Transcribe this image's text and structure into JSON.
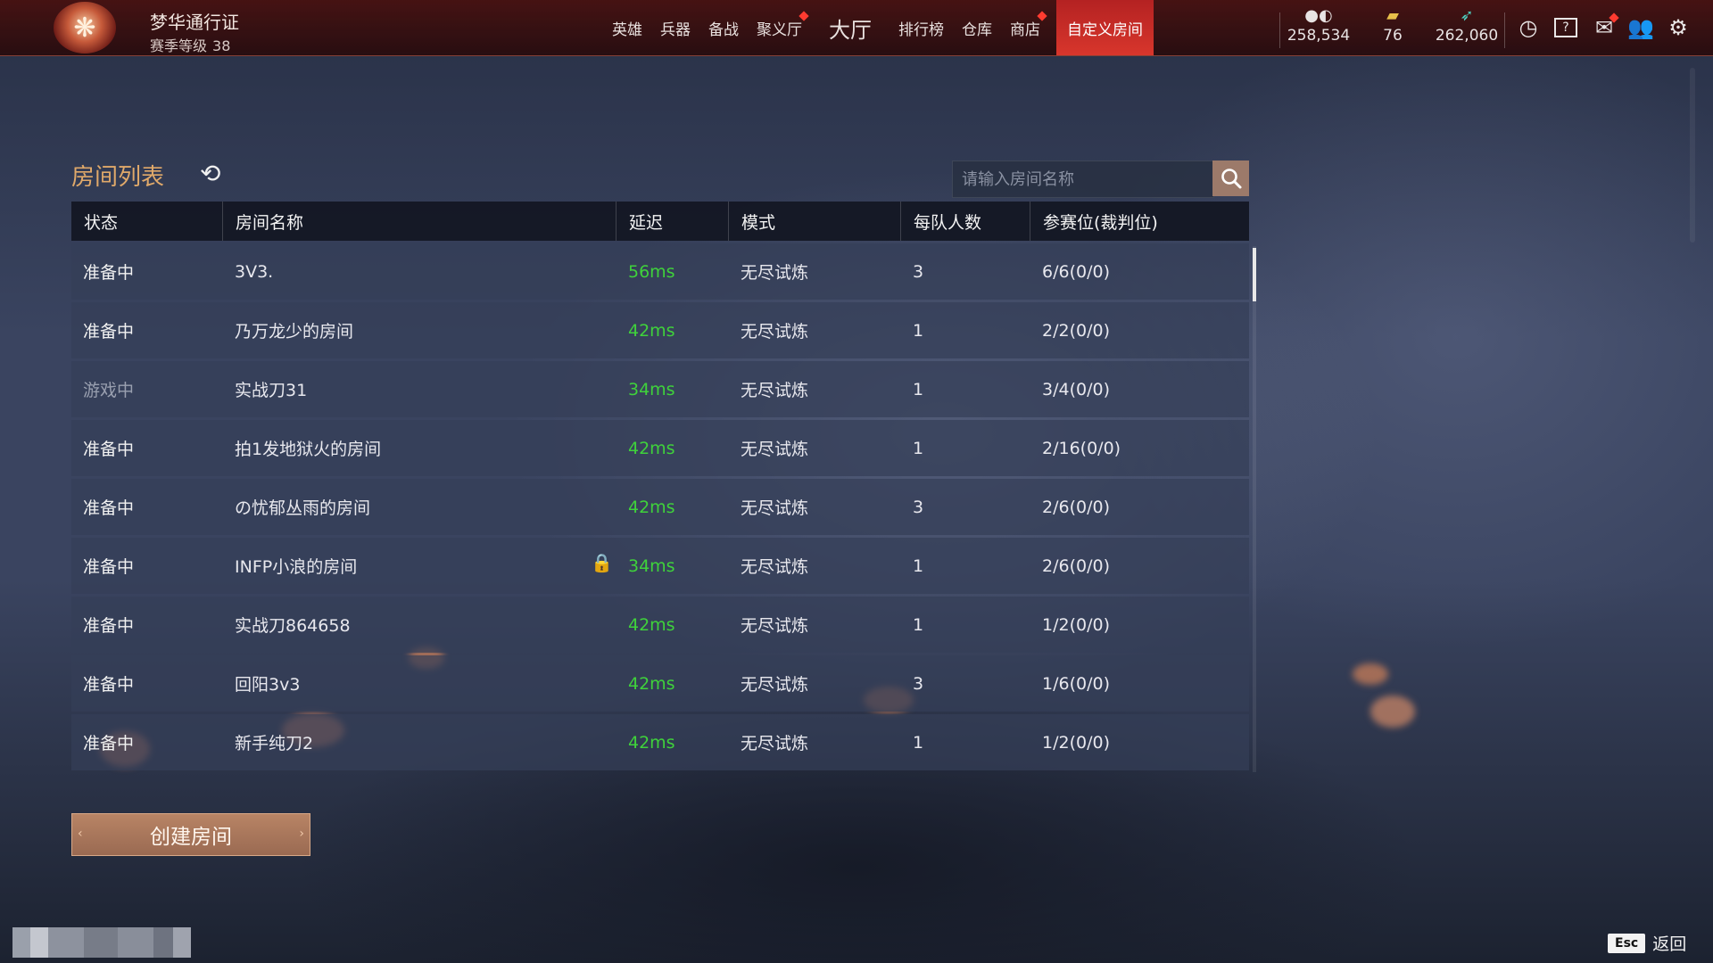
{
  "pass": {
    "title": "梦华通行证",
    "level_label": "赛季等级",
    "level": "38"
  },
  "nav": [
    {
      "label": "英雄",
      "badge": false
    },
    {
      "label": "兵器",
      "badge": false
    },
    {
      "label": "备战",
      "badge": false
    },
    {
      "label": "聚义厅",
      "badge": true
    },
    {
      "label": "大厅",
      "badge": false
    },
    {
      "label": "排行榜",
      "badge": false
    },
    {
      "label": "仓库",
      "badge": false
    },
    {
      "label": "商店",
      "badge": true
    },
    {
      "label": "自定义房间",
      "badge": false,
      "active": true
    }
  ],
  "currencies": [
    {
      "icon": "coin-icon",
      "value": "258,534"
    },
    {
      "icon": "ticket-icon",
      "value": "76"
    },
    {
      "icon": "feather-icon",
      "value": "262,060"
    }
  ],
  "room_list": {
    "title": "房间列表",
    "search_placeholder": "请输入房间名称",
    "headers": [
      "状态",
      "房间名称",
      "延迟",
      "模式",
      "每队人数",
      "参赛位(裁判位)"
    ],
    "rows": [
      {
        "status": "准备中",
        "name": "3V3.",
        "delay": "56ms",
        "mode": "无尽试炼",
        "team_size": "3",
        "seats": "6/6(0/0)",
        "locked": false
      },
      {
        "status": "准备中",
        "name": "乃万龙少的房间",
        "delay": "42ms",
        "mode": "无尽试炼",
        "team_size": "1",
        "seats": "2/2(0/0)",
        "locked": false
      },
      {
        "status": "游戏中",
        "name": "实战刀31",
        "delay": "34ms",
        "mode": "无尽试炼",
        "team_size": "1",
        "seats": "3/4(0/0)",
        "locked": false
      },
      {
        "status": "准备中",
        "name": "拍1发地狱火的房间",
        "delay": "42ms",
        "mode": "无尽试炼",
        "team_size": "1",
        "seats": "2/16(0/0)",
        "locked": false
      },
      {
        "status": "准备中",
        "name": "の忧郁丛雨的房间",
        "delay": "42ms",
        "mode": "无尽试炼",
        "team_size": "3",
        "seats": "2/6(0/0)",
        "locked": false
      },
      {
        "status": "准备中",
        "name": "INFP小浪的房间",
        "delay": "34ms",
        "mode": "无尽试炼",
        "team_size": "1",
        "seats": "2/6(0/0)",
        "locked": true
      },
      {
        "status": "准备中",
        "name": "实战刀864658",
        "delay": "42ms",
        "mode": "无尽试炼",
        "team_size": "1",
        "seats": "1/2(0/0)",
        "locked": false
      },
      {
        "status": "准备中",
        "name": "回阳3v3",
        "delay": "42ms",
        "mode": "无尽试炼",
        "team_size": "3",
        "seats": "1/6(0/0)",
        "locked": false
      },
      {
        "status": "准备中",
        "name": "新手纯刀2",
        "delay": "42ms",
        "mode": "无尽试炼",
        "team_size": "1",
        "seats": "1/2(0/0)",
        "locked": false
      }
    ]
  },
  "create_button": "创建房间",
  "esc": {
    "key": "Esc",
    "label": "返回"
  },
  "colors": {
    "active_tab": "#d8362c",
    "delay_ok": "#3fd23b",
    "title_gold": "#e0a96a",
    "create_button": "#b88465"
  }
}
